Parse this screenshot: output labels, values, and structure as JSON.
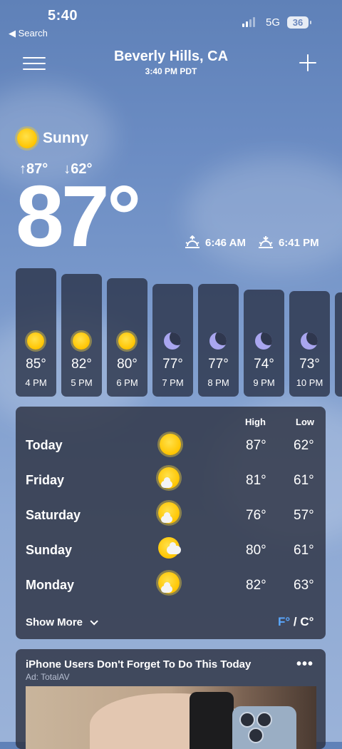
{
  "status": {
    "time": "5:40",
    "back": "◀ Search",
    "network": "5G",
    "battery": "36"
  },
  "header": {
    "city": "Beverly Hills, CA",
    "local_time": "3:40 PM PDT"
  },
  "current": {
    "condition": "Sunny",
    "high": "↑87°",
    "low": "↓62°",
    "temp": "87°",
    "sunrise": "6:46 AM",
    "sunset": "6:41 PM"
  },
  "hourly": [
    {
      "temp": "85°",
      "hour": "4 PM",
      "icon": "sun-icon"
    },
    {
      "temp": "82°",
      "hour": "5 PM",
      "icon": "sun-icon"
    },
    {
      "temp": "80°",
      "hour": "6 PM",
      "icon": "sun-icon"
    },
    {
      "temp": "77°",
      "hour": "7 PM",
      "icon": "moon-icon"
    },
    {
      "temp": "77°",
      "hour": "8 PM",
      "icon": "moon-icon"
    },
    {
      "temp": "74°",
      "hour": "9 PM",
      "icon": "moon-icon"
    },
    {
      "temp": "73°",
      "hour": "10 PM",
      "icon": "moon-icon"
    }
  ],
  "daily": {
    "high_label": "High",
    "low_label": "Low",
    "days": [
      {
        "day": "Today",
        "high": "87°",
        "low": "62°",
        "icon": "sun-icon"
      },
      {
        "day": "Friday",
        "high": "81°",
        "low": "61°",
        "icon": "partly-sunny-icon"
      },
      {
        "day": "Saturday",
        "high": "76°",
        "low": "57°",
        "icon": "partly-sunny-icon"
      },
      {
        "day": "Sunday",
        "high": "80°",
        "low": "61°",
        "icon": "partly-sunny-icon"
      },
      {
        "day": "Monday",
        "high": "82°",
        "low": "63°",
        "icon": "partly-sunny-icon"
      }
    ],
    "show_more": "Show More",
    "unit_f": "F°",
    "unit_sep": " / ",
    "unit_c": "C°"
  },
  "ad": {
    "title": "iPhone Users Don't Forget To Do This Today",
    "sponsor": "Ad: TotalAV",
    "menu": "•••"
  },
  "colors": {
    "accent_unit": "#5aa8ff",
    "sun": "#ffc400",
    "moon": "#a9a6ef",
    "card": "#2d3242"
  }
}
